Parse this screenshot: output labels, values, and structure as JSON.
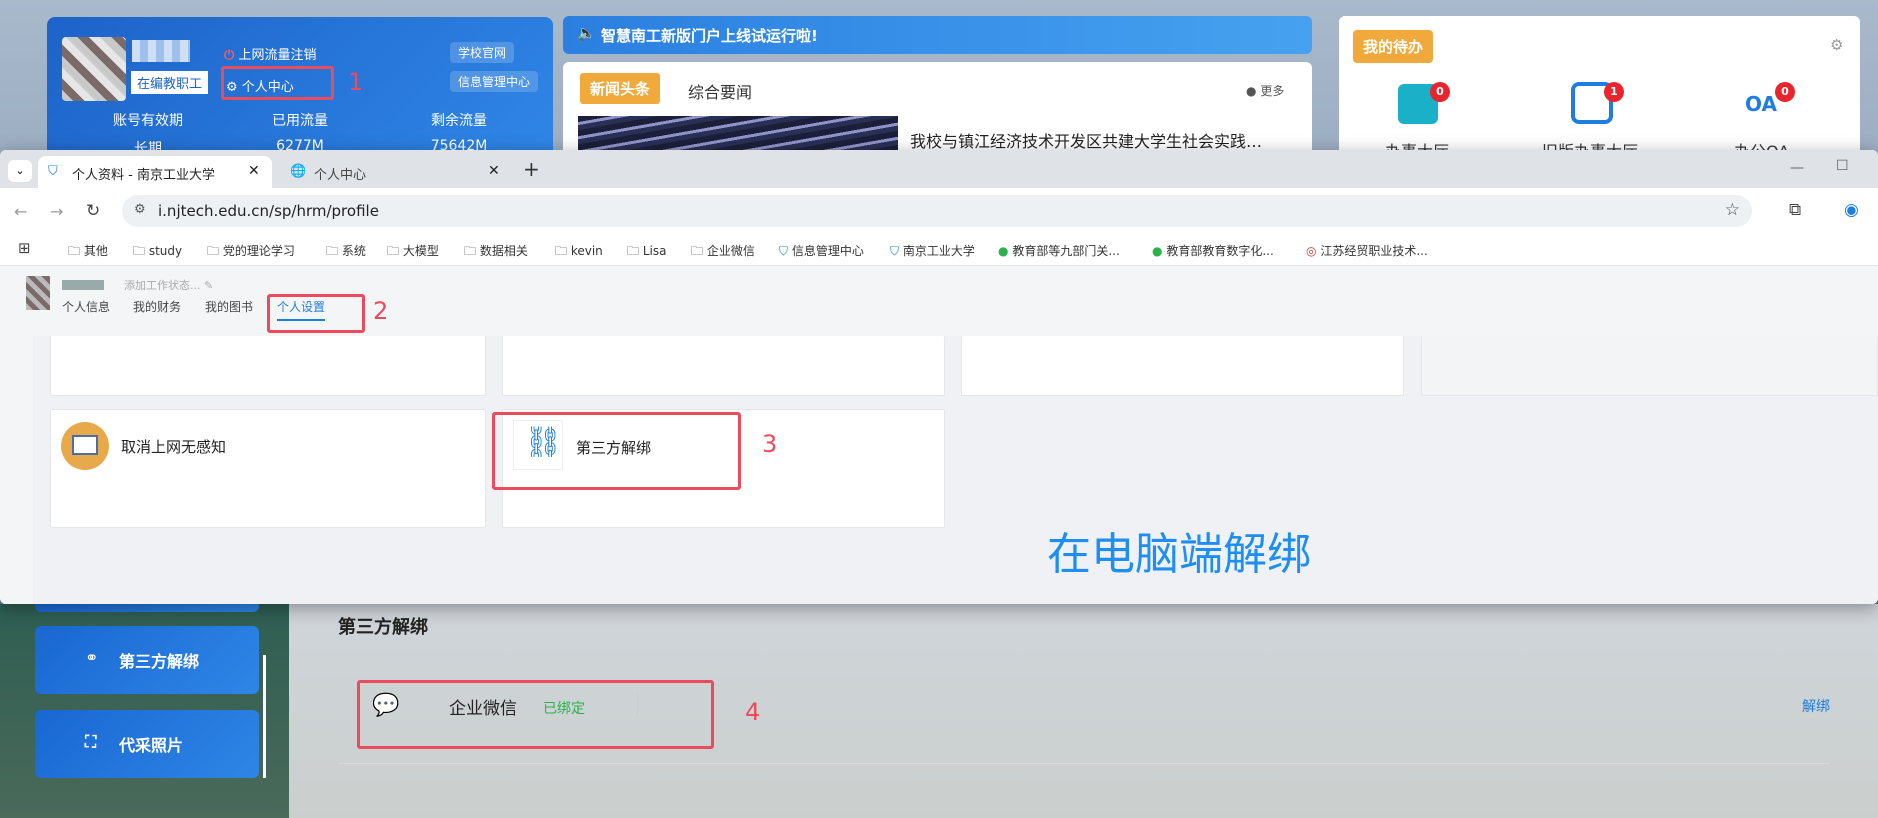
{
  "portal": {
    "staff_tag": "在编教职工",
    "logout_link": "上网流量注销",
    "personal_center_link": "个人中心",
    "school_site": "学校官网",
    "info_center": "信息管理中心",
    "stats": [
      {
        "label": "账号有效期",
        "value": "长期"
      },
      {
        "label": "已用流量",
        "value": "6277M"
      },
      {
        "label": "剩余流量",
        "value": "75642M"
      }
    ],
    "notice": "智慧南工新版门户上线试运行啦!",
    "news_tabs": [
      "新闻头条",
      "综合要闻"
    ],
    "news_more": "更多",
    "news_headline": "我校与镇江经济技术开发区共建大学生社会实践…",
    "todo_title": "我的待办",
    "todo_items": [
      {
        "label": "办事大厅",
        "badge": "0"
      },
      {
        "label": "旧版办事大厅",
        "badge": "1"
      },
      {
        "label": "办公OA",
        "badge": "0"
      }
    ]
  },
  "browser": {
    "tabs": [
      {
        "title": "个人资料 - 南京工业大学"
      },
      {
        "title": "个人中心"
      }
    ],
    "url": "i.njtech.edu.cn/sp/hrm/profile",
    "bookmarks": [
      "其他",
      "study",
      "党的理论学习",
      "系统",
      "大模型",
      "数据相关",
      "kevin",
      "Lisa",
      "企业微信",
      "信息管理中心",
      "南京工业大学",
      "教育部等九部门关...",
      "教育部教育数字化...",
      "江苏经贸职业技术..."
    ],
    "profile": {
      "status_placeholder": "添加工作状态..."
    },
    "nav": [
      "个人信息",
      "我的财务",
      "我的图书",
      "个人设置"
    ],
    "cards": [
      "取消上网无感知",
      "第三方解绑"
    ],
    "caption": "在电脑端解绑"
  },
  "page": {
    "sidebar": [
      "第三方解绑",
      "代采照片"
    ],
    "section_title": "第三方解绑",
    "binding": {
      "name": "企业微信",
      "status": "已绑定",
      "action": "解绑"
    }
  },
  "annotations": [
    "1",
    "2",
    "3",
    "4"
  ],
  "colors": {
    "annotation": "#ec4b5d",
    "accent": "#1f8ef1",
    "bound": "#2bb24c",
    "orange": "#f0a93a"
  }
}
